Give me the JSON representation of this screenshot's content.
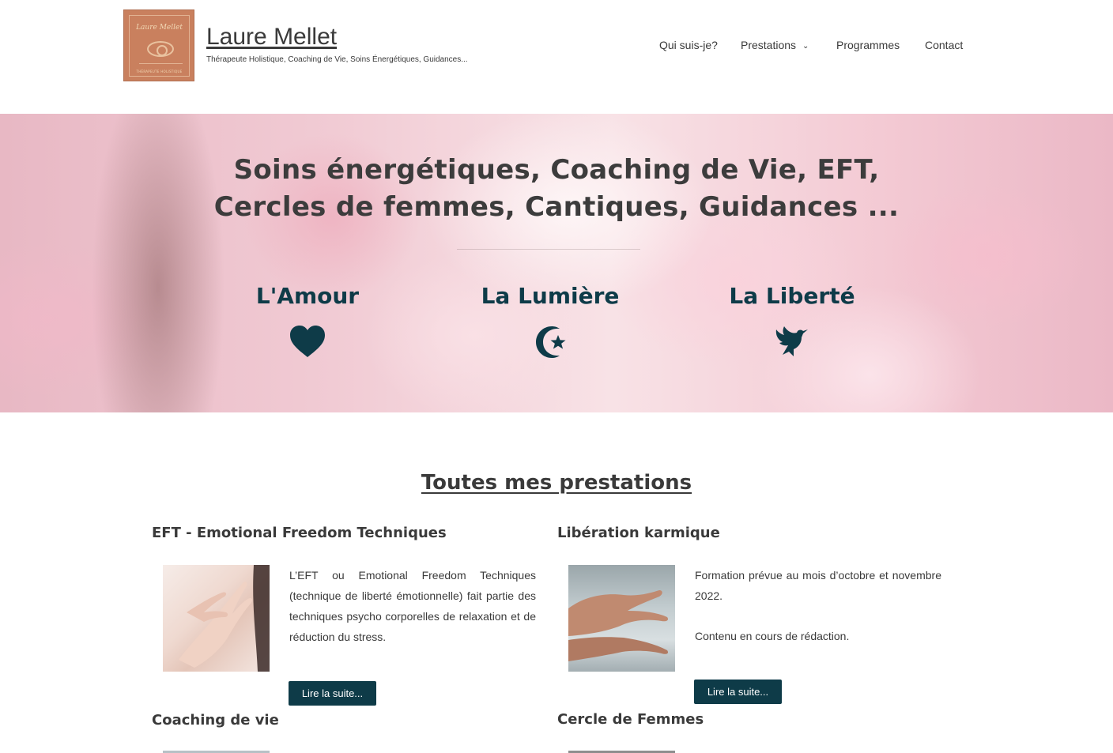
{
  "site": {
    "title": "Laure Mellet",
    "tagline": "Thérapeute Holistique, Coaching de Vie, Soins Énergétiques, Guidances...",
    "logo_script": "Laure Mellet",
    "logo_subtitle": "THÉRAPEUTE HOLISTIQUE"
  },
  "nav": {
    "items": [
      {
        "label": "Qui suis-je?"
      },
      {
        "label": "Prestations",
        "has_dropdown": true
      },
      {
        "label": "Programmes"
      },
      {
        "label": "Contact"
      }
    ]
  },
  "hero": {
    "title_line1": "Soins énergétiques, Coaching de Vie, EFT,",
    "title_line2": "Cercles de femmes, Cantiques, Guidances ...",
    "pillars": [
      {
        "title": "L'Amour",
        "icon": "heart-icon"
      },
      {
        "title": "La Lumière",
        "icon": "star-and-crescent-icon"
      },
      {
        "title": "La Liberté",
        "icon": "dove-icon"
      }
    ]
  },
  "services": {
    "section_title": "Toutes mes prestations",
    "cards": [
      {
        "title": "EFT - Emotional Freedom Techniques",
        "text": "L’EFT ou Emotional Freedom Techniques (technique de liberté émotionnelle) fait partie des techniques psycho corporelles de relaxation et de réduction du stress.",
        "button": "Lire la suite..."
      },
      {
        "title": "Libération karmique",
        "text": "Formation prévue au mois d’octobre et novembre 2022.",
        "text2": "Contenu en cours de rédaction.",
        "button": "Lire la suite..."
      },
      {
        "title": "Coaching de vie"
      },
      {
        "title": "Cercle de Femmes"
      }
    ]
  },
  "colors": {
    "accent": "#0e3b48",
    "text": "#3a3a3a",
    "logo_bg": "#c9805e"
  }
}
